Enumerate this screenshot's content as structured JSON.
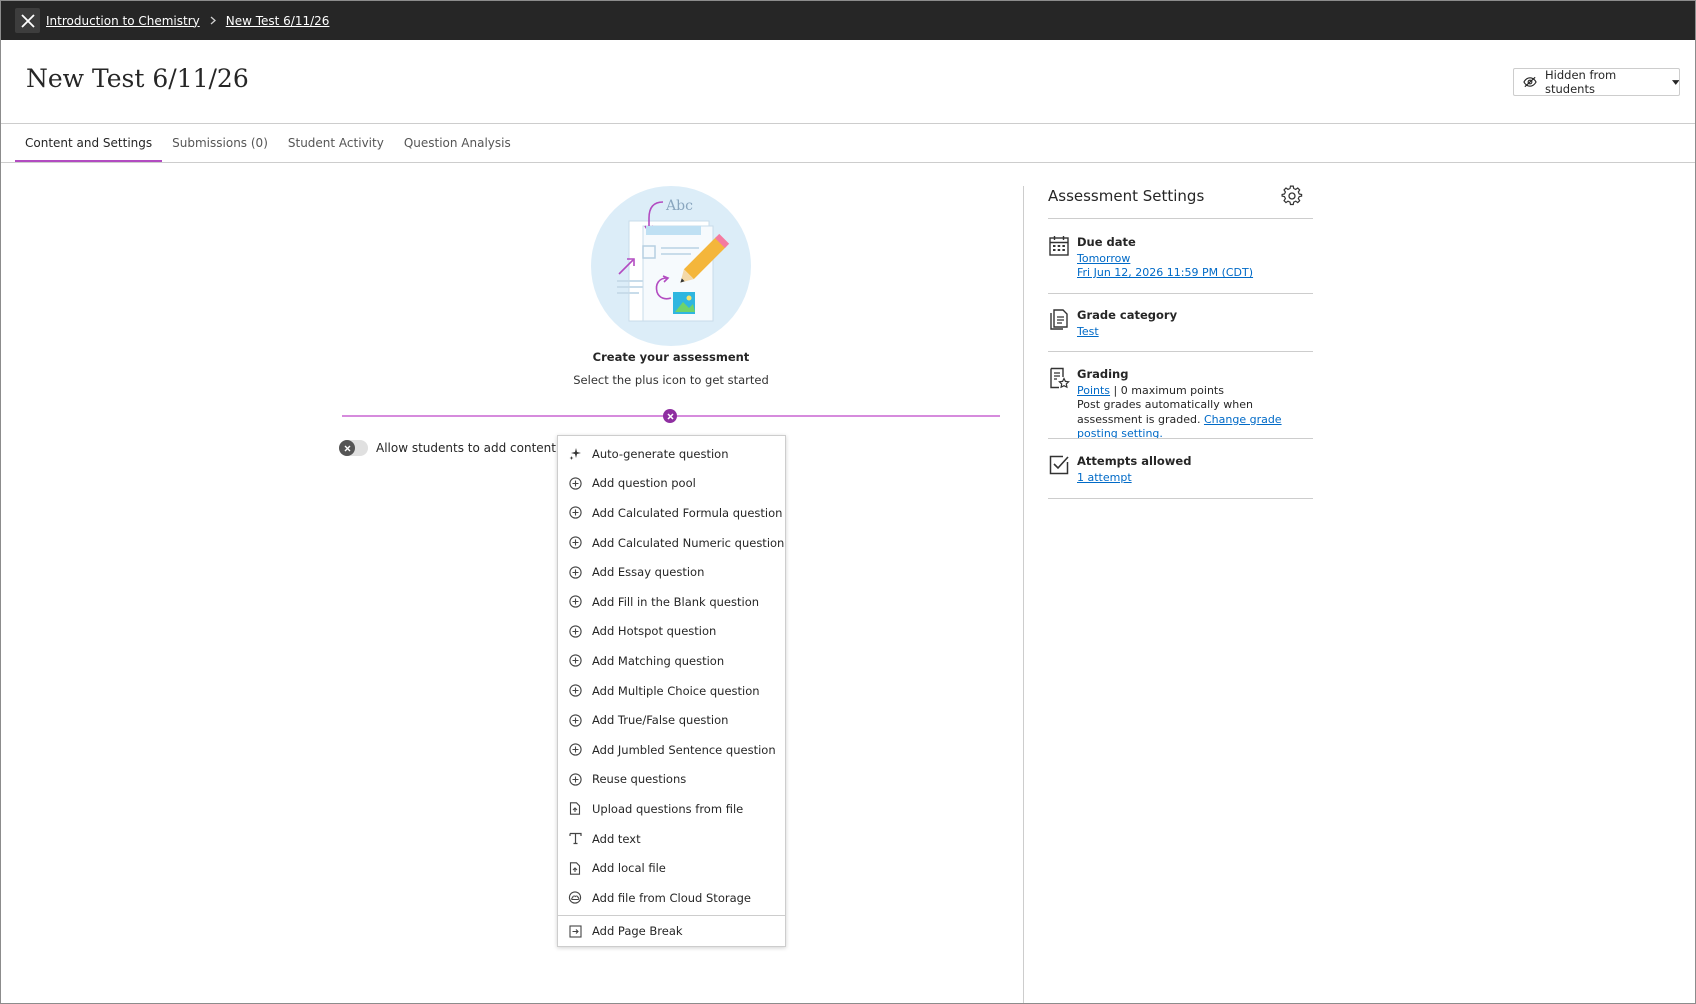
{
  "breadcrumb": {
    "course": "Introduction to Chemistry",
    "test": "New Test 6/11/26"
  },
  "header": {
    "title": "New Test 6/11/26",
    "visibility_label": "Hidden from students"
  },
  "tabs": [
    {
      "label": "Content and Settings",
      "active": true
    },
    {
      "label": "Submissions (0)",
      "active": false
    },
    {
      "label": "Student Activity",
      "active": false
    },
    {
      "label": "Question Analysis",
      "active": false
    }
  ],
  "empty_state": {
    "title": "Create your assessment",
    "subtitle": "Select the plus icon to get started",
    "illustration_text": "Abc"
  },
  "toggle": {
    "label": "Allow students to add content at e",
    "on": false
  },
  "add_menu": {
    "items": [
      {
        "label": "Auto-generate question",
        "icon": "sparkle-icon"
      },
      {
        "label": "Add question pool",
        "icon": "plus-circle-icon"
      },
      {
        "label": "Add Calculated Formula question",
        "icon": "plus-circle-icon"
      },
      {
        "label": "Add Calculated Numeric question",
        "icon": "plus-circle-icon"
      },
      {
        "label": "Add Essay question",
        "icon": "plus-circle-icon"
      },
      {
        "label": "Add Fill in the Blank question",
        "icon": "plus-circle-icon"
      },
      {
        "label": "Add Hotspot question",
        "icon": "plus-circle-icon"
      },
      {
        "label": "Add Matching question",
        "icon": "plus-circle-icon"
      },
      {
        "label": "Add Multiple Choice question",
        "icon": "plus-circle-icon"
      },
      {
        "label": "Add True/False question",
        "icon": "plus-circle-icon"
      },
      {
        "label": "Add Jumbled Sentence question",
        "icon": "plus-circle-icon"
      },
      {
        "label": "Reuse questions",
        "icon": "plus-circle-icon"
      },
      {
        "label": "Upload questions from file",
        "icon": "file-upload-icon"
      },
      {
        "label": "Add text",
        "icon": "text-icon"
      },
      {
        "label": "Add local file",
        "icon": "file-upload-icon"
      },
      {
        "label": "Add file from Cloud Storage",
        "icon": "cloud-icon"
      }
    ],
    "page_break": {
      "label": "Add Page Break",
      "icon": "page-break-icon"
    }
  },
  "settings": {
    "title": "Assessment Settings",
    "due_date": {
      "heading": "Due date",
      "relative": "Tomorrow",
      "absolute": "Fri Jun 12, 2026 11:59 PM (CDT)"
    },
    "grade_category": {
      "heading": "Grade category",
      "value": "Test"
    },
    "grading": {
      "heading": "Grading",
      "scheme": "Points",
      "separator": "|",
      "max_points": "0 maximum points",
      "note": "Post grades automatically when assessment is graded.",
      "link": "Change grade posting setting."
    },
    "attempts": {
      "heading": "Attempts allowed",
      "value": "1 attempt"
    }
  },
  "colors": {
    "topbar": "#262626",
    "accent": "#b24bc1",
    "link": "#006ac7"
  }
}
